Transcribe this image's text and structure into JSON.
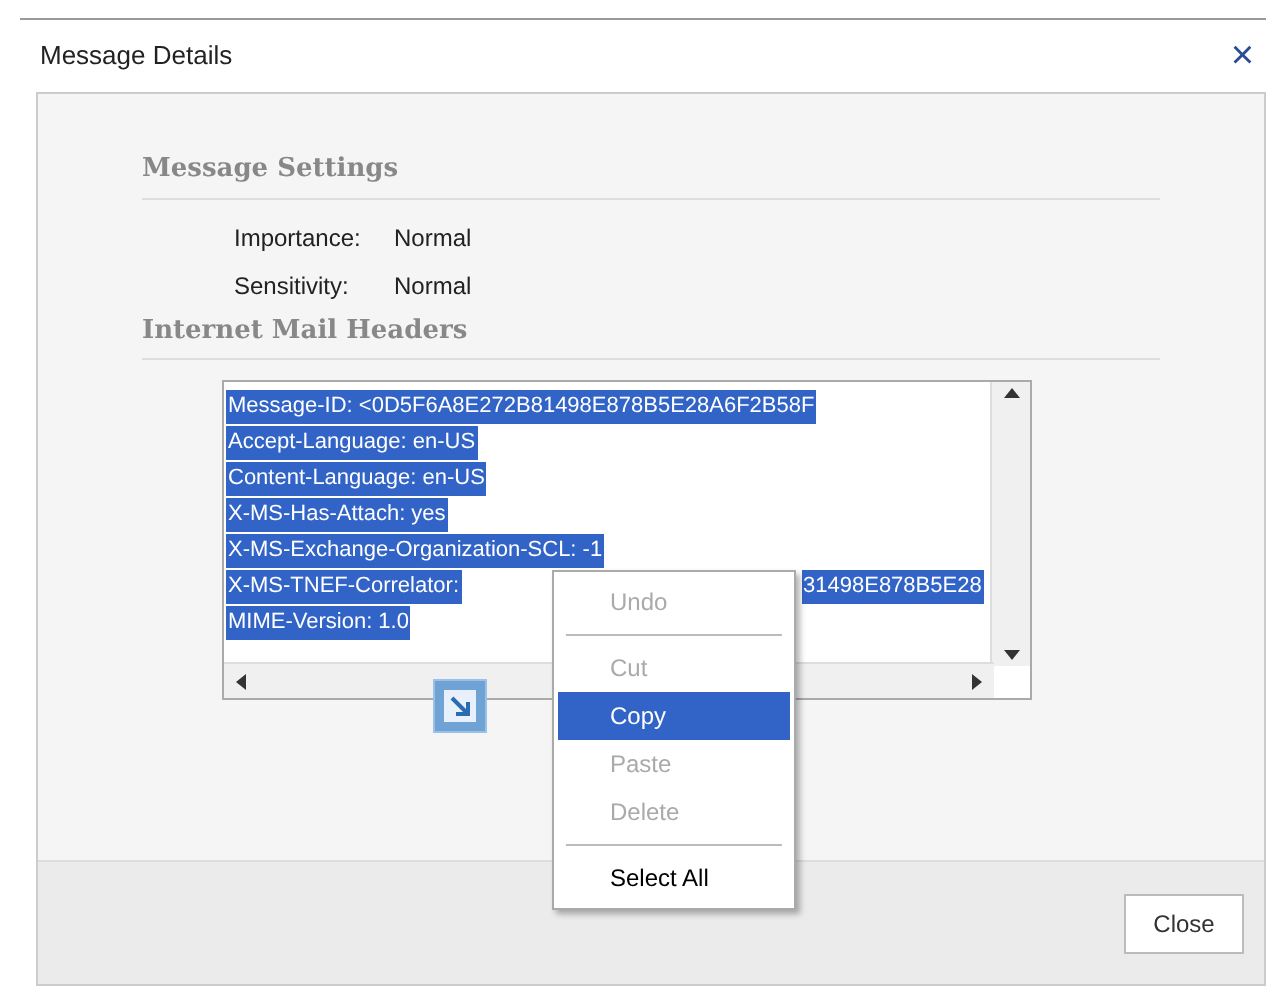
{
  "window": {
    "title": "Message Details",
    "close": "×"
  },
  "settings": {
    "heading": "Message Settings",
    "fields": [
      {
        "label": "Importance:",
        "value": "Normal"
      },
      {
        "label": "Sensitivity:",
        "value": "Normal"
      }
    ]
  },
  "headers": {
    "heading": "Internet Mail Headers",
    "lines": [
      {
        "text": "Message-ID: <0D5F6A8E272B81498E878B5E28A6F2B58F",
        "selected": true
      },
      {
        "text": "Accept-Language: en-US",
        "selected": true
      },
      {
        "text": "Content-Language: en-US",
        "selected": true
      },
      {
        "text": "X-MS-Has-Attach: yes",
        "selected": true
      },
      {
        "text": "X-MS-Exchange-Organization-SCL: -1",
        "selected": true
      },
      {
        "text": "X-MS-TNEF-Correlator:",
        "tail": "31498E878B5E28",
        "selected": true
      },
      {
        "text": "MIME-Version: 1.0",
        "selected": true
      }
    ]
  },
  "context_menu": [
    {
      "kind": "item",
      "label": "Undo",
      "disabled": true,
      "selected": false
    },
    {
      "kind": "separator"
    },
    {
      "kind": "item",
      "label": "Cut",
      "disabled": true,
      "selected": false
    },
    {
      "kind": "item",
      "label": "Copy",
      "disabled": false,
      "selected": true
    },
    {
      "kind": "item",
      "label": "Paste",
      "disabled": true,
      "selected": false
    },
    {
      "kind": "item",
      "label": "Delete",
      "disabled": true,
      "selected": false
    },
    {
      "kind": "separator"
    },
    {
      "kind": "item",
      "label": "Select All",
      "disabled": false,
      "selected": false
    }
  ],
  "buttons": [
    {
      "label": "Close"
    }
  ]
}
